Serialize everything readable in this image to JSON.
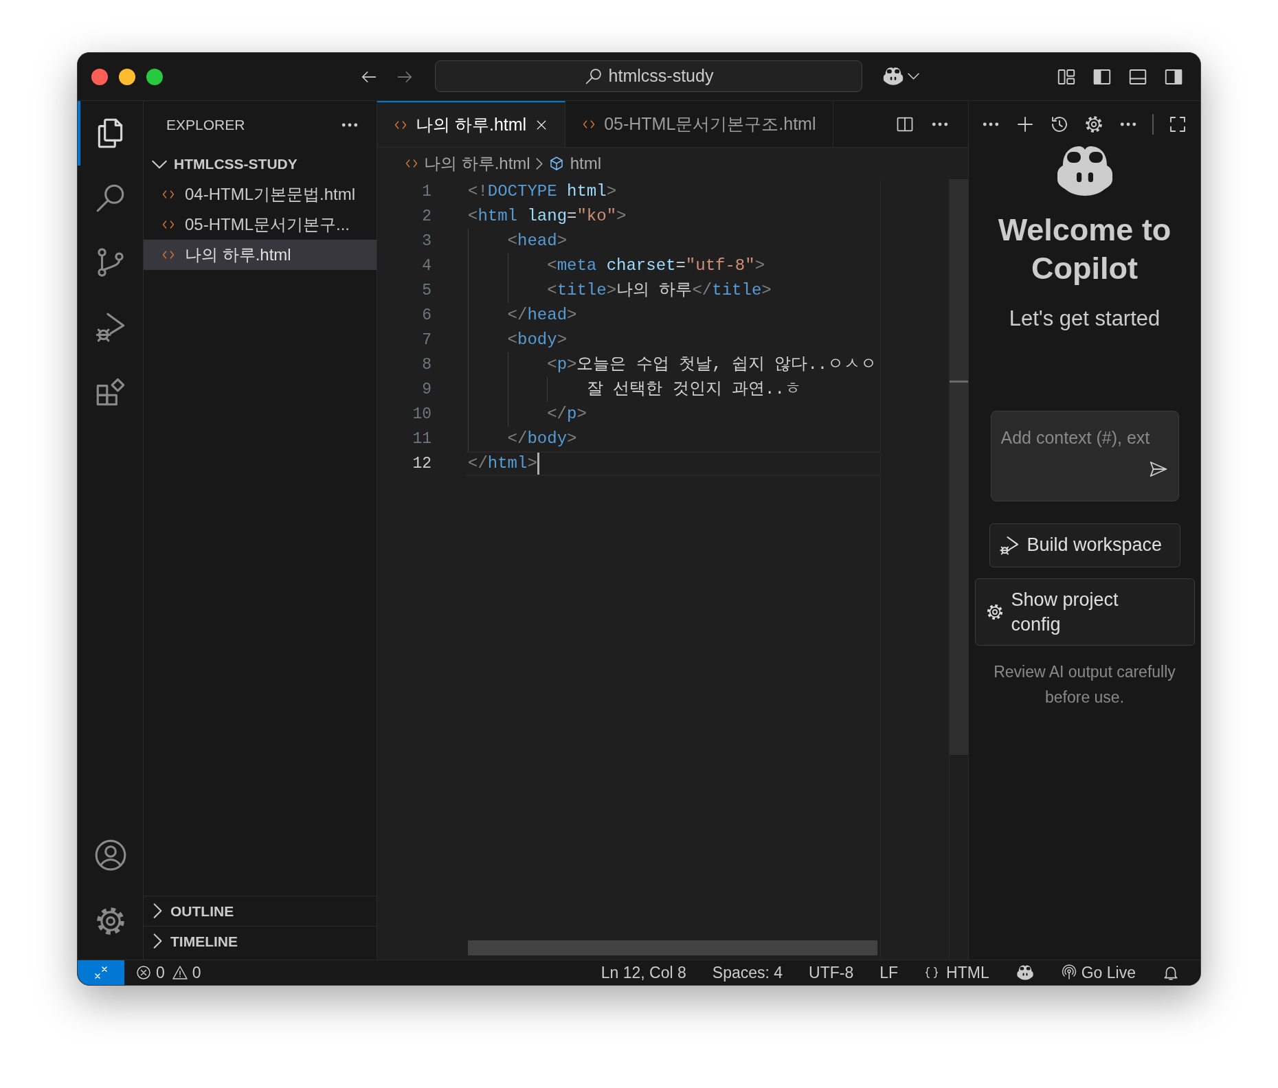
{
  "window": {
    "search": "htmlcss-study"
  },
  "activity_bar": {
    "items": [
      {
        "kind": "files",
        "selected": true
      },
      {
        "kind": "search",
        "selected": false
      },
      {
        "kind": "source-control",
        "selected": false
      },
      {
        "kind": "run-debug",
        "selected": false
      },
      {
        "kind": "extensions",
        "selected": false
      }
    ],
    "bottom": [
      {
        "kind": "account"
      },
      {
        "kind": "gear"
      }
    ]
  },
  "sidebar": {
    "title": "EXPLORER",
    "folder": {
      "name": "HTMLCSS-STUDY",
      "expanded": true,
      "children": [
        {
          "name": "04-HTML기본문법.html",
          "selected": false
        },
        {
          "name": "05-HTML문서기본구...",
          "selected": false
        },
        {
          "name": "나의 하루.html",
          "selected": true
        }
      ]
    },
    "sections": [
      {
        "name": "OUTLINE",
        "expanded": false
      },
      {
        "name": "TIMELINE",
        "expanded": false
      }
    ]
  },
  "tabs": [
    {
      "label": "나의 하루.html",
      "selected": true
    },
    {
      "label": "05-HTML문서기본구조.html",
      "selected": false
    }
  ],
  "breadcrumbs": [
    {
      "label": "나의 하루.html",
      "kind": "file"
    },
    {
      "label": "html",
      "kind": "element"
    }
  ],
  "editor": {
    "lines": [
      {
        "number": "1",
        "current": false,
        "tokens": [
          {
            "text": "<!",
            "kind": "punct"
          },
          {
            "text": "DOCTYPE",
            "kind": "tag"
          },
          {
            "text": " html",
            "kind": "attr"
          },
          {
            "text": ">",
            "kind": "punct"
          }
        ]
      },
      {
        "number": "2",
        "current": false,
        "tokens": [
          {
            "text": "<",
            "kind": "punct"
          },
          {
            "text": "html",
            "kind": "tag"
          },
          {
            "text": " lang",
            "kind": "attr"
          },
          {
            "text": "=",
            "kind": "text"
          },
          {
            "text": "\"ko\"",
            "kind": "string"
          },
          {
            "text": ">",
            "kind": "punct"
          }
        ]
      },
      {
        "number": "3",
        "current": false,
        "tokens": [
          {
            "text": "    <",
            "kind": "punct"
          },
          {
            "text": "head",
            "kind": "tag"
          },
          {
            "text": ">",
            "kind": "punct"
          }
        ]
      },
      {
        "number": "4",
        "current": false,
        "tokens": [
          {
            "text": "        <",
            "kind": "punct"
          },
          {
            "text": "meta",
            "kind": "tag"
          },
          {
            "text": " charset",
            "kind": "attr"
          },
          {
            "text": "=",
            "kind": "text"
          },
          {
            "text": "\"utf-8\"",
            "kind": "string"
          },
          {
            "text": ">",
            "kind": "punct"
          }
        ]
      },
      {
        "number": "5",
        "current": false,
        "tokens": [
          {
            "text": "        <",
            "kind": "punct"
          },
          {
            "text": "title",
            "kind": "tag"
          },
          {
            "text": ">",
            "kind": "punct"
          },
          {
            "text": "나의 하루",
            "kind": "text"
          },
          {
            "text": "</",
            "kind": "punct"
          },
          {
            "text": "title",
            "kind": "tag"
          },
          {
            "text": ">",
            "kind": "punct"
          }
        ]
      },
      {
        "number": "6",
        "current": false,
        "tokens": [
          {
            "text": "    </",
            "kind": "punct"
          },
          {
            "text": "head",
            "kind": "tag"
          },
          {
            "text": ">",
            "kind": "punct"
          }
        ]
      },
      {
        "number": "7",
        "current": false,
        "tokens": [
          {
            "text": "    <",
            "kind": "punct"
          },
          {
            "text": "body",
            "kind": "tag"
          },
          {
            "text": ">",
            "kind": "punct"
          }
        ]
      },
      {
        "number": "8",
        "current": false,
        "tokens": [
          {
            "text": "        <",
            "kind": "punct"
          },
          {
            "text": "p",
            "kind": "tag"
          },
          {
            "text": ">",
            "kind": "punct"
          },
          {
            "text": "오늘은 수업 첫날, 쉽지 않다..ㅇㅅㅇ",
            "kind": "text"
          }
        ]
      },
      {
        "number": "9",
        "current": false,
        "tokens": [
          {
            "text": "            잘 선택한 것인지 과연..ㅎ",
            "kind": "text"
          }
        ]
      },
      {
        "number": "10",
        "current": false,
        "tokens": [
          {
            "text": "        </",
            "kind": "punct"
          },
          {
            "text": "p",
            "kind": "tag"
          },
          {
            "text": ">",
            "kind": "punct"
          }
        ]
      },
      {
        "number": "11",
        "current": false,
        "tokens": [
          {
            "text": "    </",
            "kind": "punct"
          },
          {
            "text": "body",
            "kind": "tag"
          },
          {
            "text": ">",
            "kind": "punct"
          }
        ]
      },
      {
        "number": "12",
        "current": true,
        "tokens": [
          {
            "text": "</",
            "kind": "punct"
          },
          {
            "text": "html",
            "kind": "tag"
          },
          {
            "text": ">",
            "kind": "punct"
          }
        ]
      }
    ]
  },
  "chat": {
    "title": "Welcome to Copilot",
    "subtitle": "Let's get started",
    "input": {
      "placeholder": "Add context (#), ext"
    },
    "actions": [
      {
        "label": "Build workspace",
        "kind": "debug"
      },
      {
        "label": "Show project config",
        "kind": "gear"
      }
    ],
    "disclaimer": "Review AI output carefully before use."
  },
  "status_bar": {
    "errors": "0",
    "warnings": "0",
    "items": [
      {
        "kind": "text",
        "label": "Ln 12, Col 8"
      },
      {
        "kind": "text",
        "label": "Spaces: 4"
      },
      {
        "kind": "text",
        "label": "UTF-8"
      },
      {
        "kind": "text",
        "label": "LF"
      },
      {
        "kind": "language",
        "label": "HTML"
      },
      {
        "kind": "copilot"
      },
      {
        "kind": "live",
        "label": "Go Live"
      },
      {
        "kind": "bell"
      }
    ]
  }
}
